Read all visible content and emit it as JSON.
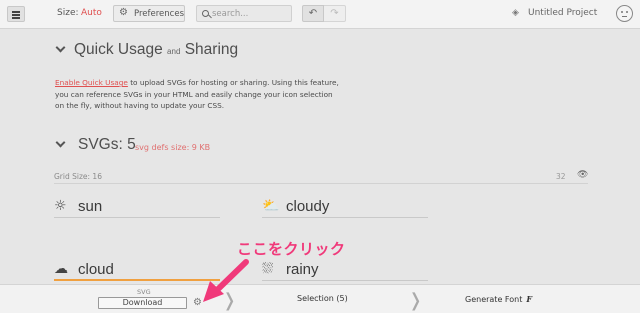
{
  "toolbar": {
    "size_label": "Size:",
    "size_value": "Auto",
    "preferences_label": "Preferences",
    "search_placeholder": "search...",
    "project_name": "Untitled Project"
  },
  "quick_usage": {
    "title": "Quick Usage",
    "title_and": "and",
    "title_sharing": "Sharing",
    "link_text": "Enable Quick Usage",
    "desc_line1": " to upload SVGs for hosting or sharing. Using this feature,",
    "desc_line2": "you can reference SVGs in your HTML and easily change your icon selection",
    "desc_line3": "on the fly, without having to update your CSS."
  },
  "svgs": {
    "title": "SVGs: 5",
    "defs_size": "svg defs size: 9 KB",
    "grid_label": "Grid Size: 16",
    "grid_value": "32"
  },
  "glyphs": [
    {
      "name": "sun",
      "icon": "sun-icon"
    },
    {
      "name": "cloudy",
      "icon": "cloudy-icon"
    },
    {
      "name": "cloud",
      "icon": "cloud-icon"
    },
    {
      "name": "rainy",
      "icon": "rainy-icon"
    }
  ],
  "annotation": "ここをクリック",
  "bottom": {
    "format_label": "SVG",
    "download_label": "Download",
    "selection_label": "Selection (5)",
    "generate_label": "Generate Font"
  },
  "colors": {
    "accent_red": "#e05050",
    "annotation_pink": "#f0397a",
    "selected_orange": "#f0a040"
  }
}
